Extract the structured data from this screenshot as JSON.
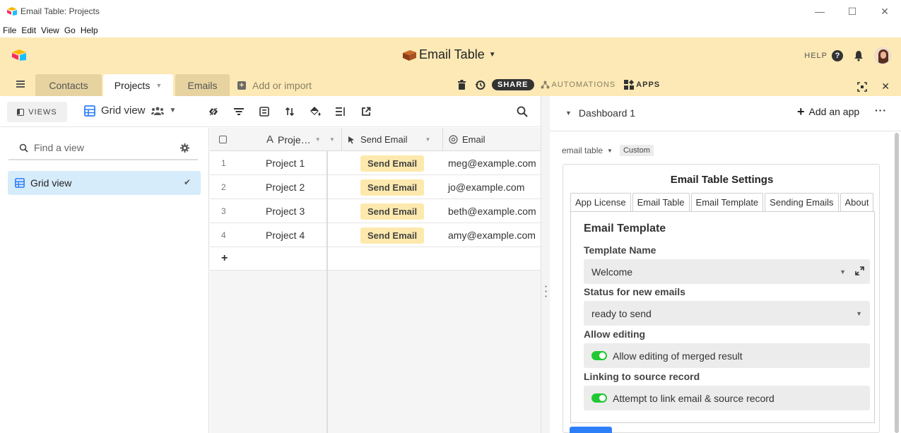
{
  "window": {
    "title": "Email Table: Projects",
    "controls": [
      "—",
      "☐",
      "✕"
    ]
  },
  "menu": [
    "File",
    "Edit",
    "View",
    "Go",
    "Help"
  ],
  "header": {
    "base_name": "Email Table",
    "help": "HELP",
    "help_icon": "?"
  },
  "tabs": {
    "items": [
      {
        "label": "Contacts"
      },
      {
        "label": "Projects"
      },
      {
        "label": "Emails"
      }
    ],
    "add_import": "Add or import",
    "share": "SHARE",
    "automations": "AUTOMATIONS",
    "apps": "APPS"
  },
  "viewbar": {
    "views": "VIEWS",
    "view_name": "Grid view"
  },
  "sidebar": {
    "find_placeholder": "Find a view",
    "items": [
      {
        "label": "Grid view"
      }
    ]
  },
  "grid": {
    "columns": [
      "Proje…",
      "Send Email",
      "Email"
    ],
    "rows": [
      {
        "num": "1",
        "project": "Project 1",
        "button": "Send Email",
        "email": "meg@example.com"
      },
      {
        "num": "2",
        "project": "Project 2",
        "button": "Send Email",
        "email": "jo@example.com"
      },
      {
        "num": "3",
        "project": "Project 3",
        "button": "Send Email",
        "email": "beth@example.com"
      },
      {
        "num": "4",
        "project": "Project 4",
        "button": "Send Email",
        "email": "amy@example.com"
      }
    ],
    "add_row": "+"
  },
  "dashboard": {
    "title": "Dashboard 1",
    "add_app": "Add an app",
    "more": "···",
    "app_name": "email table",
    "app_badge": "Custom",
    "card": {
      "title": "Email Table Settings",
      "tabs": [
        "App License",
        "Email Table",
        "Email Template",
        "Sending Emails",
        "About"
      ],
      "section_title": "Email Template",
      "fields": {
        "template_label": "Template Name",
        "template_value": "Welcome",
        "status_label": "Status for new emails",
        "status_value": "ready to send",
        "allow_label": "Allow editing",
        "allow_value": "Allow editing of merged result",
        "link_label": "Linking to source record",
        "link_value": "Attempt to link email & source record"
      }
    }
  },
  "colors": {
    "header_bg": "#fce9b5",
    "button_pill": "#fde9ad",
    "toggle_on": "#20c933",
    "selected_view": "#d6ecfb",
    "primary_button": "#2d7ff9"
  }
}
